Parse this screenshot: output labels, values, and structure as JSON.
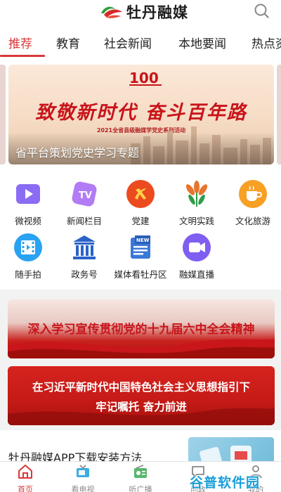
{
  "header": {
    "app_name": "牡丹融媒",
    "search_icon": "search-icon"
  },
  "tabs": [
    {
      "label": "推荐",
      "active": true
    },
    {
      "label": "教育"
    },
    {
      "label": "社会新闻"
    },
    {
      "label": "本地要闻"
    },
    {
      "label": "热点资"
    }
  ],
  "banner": {
    "slogan": "致敬新时代 奋斗百年路",
    "subtitle": "2021全省县级融媒学党史系列活动",
    "caption": "省平台策划党史学习专题",
    "emblem_number": "100"
  },
  "grid": [
    {
      "label": "微视频",
      "icon": "video-icon",
      "color": "#7b5cf0"
    },
    {
      "label": "新闻栏目",
      "icon": "tv-icon",
      "color": "#a46cf4"
    },
    {
      "label": "党建",
      "icon": "party-emblem-icon",
      "color": "#e8451e"
    },
    {
      "label": "文明实践",
      "icon": "peony-icon",
      "color": "#e06a2c"
    },
    {
      "label": "文化旅游",
      "icon": "coffee-cup-icon",
      "color": "#f59a1f"
    },
    {
      "label": "随手拍",
      "icon": "film-icon",
      "color": "#2b9ff0"
    },
    {
      "label": "政务号",
      "icon": "government-building-icon",
      "color": "#2a62c9"
    },
    {
      "label": "媒体看牡丹区",
      "icon": "newspaper-icon",
      "color": "#3a78d8"
    },
    {
      "label": "融媒直播",
      "icon": "live-camera-icon",
      "color": "#7a5cf0"
    }
  ],
  "promos": {
    "promo1_text": "深入学习宣传贯彻党的十九届六中全会精神",
    "promo2_line1": "在习近平新时代中国特色社会主义思想指引下",
    "promo2_line2": "牢记嘱托 奋力前进"
  },
  "article": {
    "title": "牡丹融媒APP下载安装方法"
  },
  "bottom_nav": [
    {
      "label": "首页",
      "icon": "home-icon",
      "active": true
    },
    {
      "label": "看电视",
      "icon": "tv-icon"
    },
    {
      "label": "听广播",
      "icon": "radio-icon"
    },
    {
      "label": "问政",
      "icon": "chat-icon"
    },
    {
      "label": "我的",
      "icon": "user-icon"
    }
  ],
  "watermark": "谷普软件园",
  "colors": {
    "accent": "#d9383a",
    "tab_text": "#222222",
    "nav_inactive": "#888888"
  }
}
